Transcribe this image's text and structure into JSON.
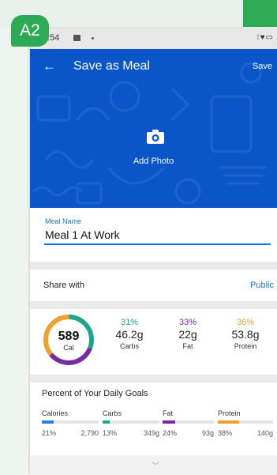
{
  "badge": "A2",
  "status_bar": {
    "time": ":54"
  },
  "header": {
    "title": "Save as Meal",
    "save_label": "Save",
    "add_photo_label": "Add Photo"
  },
  "meal_name": {
    "label": "Meal Name",
    "value": "Meal 1 At Work"
  },
  "share": {
    "label": "Share with",
    "value": "Public"
  },
  "calories": {
    "value": "589",
    "label": "Cal"
  },
  "macros": [
    {
      "pct": "31%",
      "amount": "46.2g",
      "label": "Carbs",
      "color": "#1fa68a"
    },
    {
      "pct": "33%",
      "amount": "22g",
      "label": "Fat",
      "color": "#7a2aa0"
    },
    {
      "pct": "36%",
      "amount": "53.8g",
      "label": "Protein",
      "color": "#f0a030"
    }
  ],
  "goals": {
    "title": "Percent of Your Daily Goals",
    "items": [
      {
        "name": "Calories",
        "pct": "21%",
        "goal": "2,790",
        "fill": 0.21,
        "color": "#2a7de1"
      },
      {
        "name": "Carbs",
        "pct": "13%",
        "goal": "349g",
        "fill": 0.13,
        "color": "#1fa68a"
      },
      {
        "name": "Fat",
        "pct": "24%",
        "goal": "93g",
        "fill": 0.24,
        "color": "#7a2aa0"
      },
      {
        "name": "Protein",
        "pct": "38%",
        "goal": "140g",
        "fill": 0.38,
        "color": "#f0a030"
      }
    ]
  },
  "colors": {
    "header_bg": "#0a55c8",
    "accent": "#1a73e8",
    "badge": "#2eaa55"
  },
  "icons": [
    "back-arrow-icon",
    "camera-icon",
    "chevron-down-icon"
  ]
}
